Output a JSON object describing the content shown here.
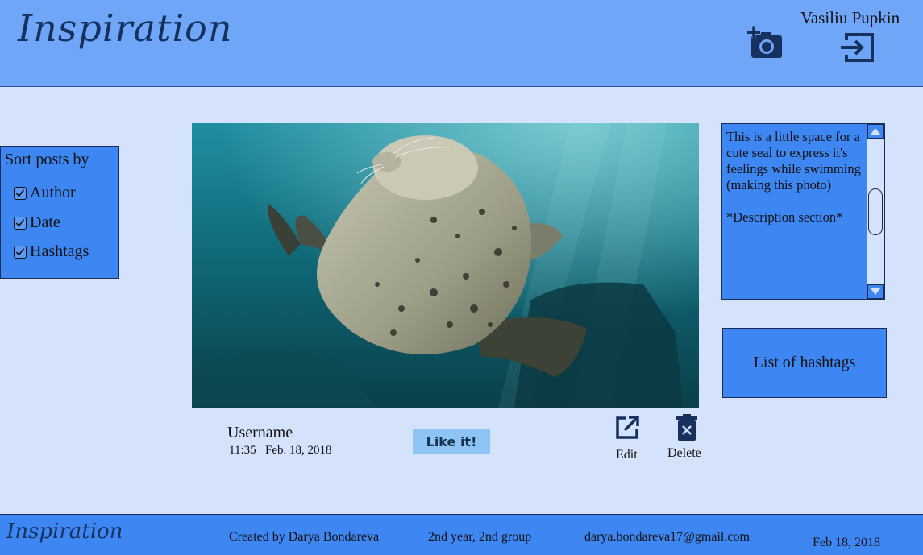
{
  "header": {
    "logo": "Inspiration",
    "user_name": "Vasiliu Pupkin",
    "add_photo_icon": "add-photo-icon",
    "logout_icon": "logout-icon"
  },
  "sort": {
    "title": "Sort posts by",
    "items": [
      {
        "label": "Author",
        "checked": true
      },
      {
        "label": "Date",
        "checked": true
      },
      {
        "label": "Hashtags",
        "checked": true
      }
    ]
  },
  "post": {
    "username": "Username",
    "time": "11:35",
    "date": "Feb. 18, 2018",
    "like_label": "Like it!",
    "edit_label": "Edit",
    "delete_label": "Delete",
    "description": "This is a little space for a cute seal to express it's feelings while swimming (making this photo)\n\n*Description section*",
    "hashtags_label": "List of hashtags"
  },
  "footer": {
    "logo": "Inspiration",
    "created_by": "Created by Darya Bondareva",
    "group": "2nd year, 2nd group",
    "email": "darya.bondareva17@gmail.com",
    "date": "Feb 18, 2018"
  },
  "colors": {
    "header_bg": "#6fa6f8",
    "page_bg": "#d4e3fb",
    "panel_bg": "#3e86f1",
    "icon_color": "#16315e",
    "like_bg": "#8ec4f4"
  }
}
